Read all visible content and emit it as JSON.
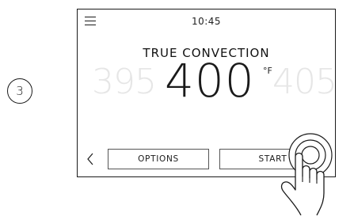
{
  "step": {
    "number": "3"
  },
  "screen": {
    "clock": "10:45",
    "mode_title": "TRUE CONVECTION",
    "temperature": {
      "previous": "395",
      "current": "400",
      "unit": "°F",
      "next": "405"
    },
    "buttons": {
      "options_label": "OPTIONS",
      "start_label": "START"
    }
  },
  "icons": {
    "menu": "hamburger-menu-icon",
    "back": "chevron-left-icon",
    "tap": "tapping-hand-icon"
  }
}
